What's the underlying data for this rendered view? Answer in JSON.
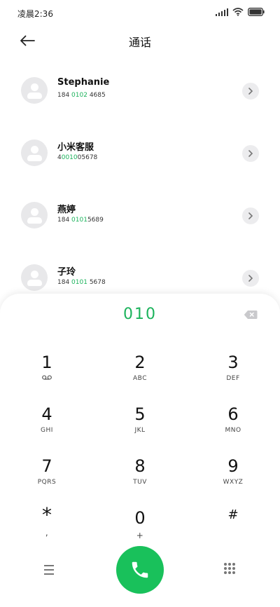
{
  "status": {
    "time": "凌晨2:36"
  },
  "header": {
    "title": "通话"
  },
  "contacts": [
    {
      "name": "Stephanie",
      "number_pre": "184 ",
      "number_hl": "0102",
      "number_post": " 4685"
    },
    {
      "name": "小米客服",
      "number_pre": "4",
      "number_hl": "0010",
      "number_post": "05678"
    },
    {
      "name": "燕婷",
      "number_pre": "184 ",
      "number_hl": "0101",
      "number_post": "5689"
    },
    {
      "name": "子玲",
      "number_pre": "184 ",
      "number_hl": "0101",
      "number_post": " 5678"
    }
  ],
  "dial": {
    "entered": "010"
  },
  "keypad": [
    {
      "digit": "1",
      "letters": ""
    },
    {
      "digit": "2",
      "letters": "ABC"
    },
    {
      "digit": "3",
      "letters": "DEF"
    },
    {
      "digit": "4",
      "letters": "GHI"
    },
    {
      "digit": "5",
      "letters": "JKL"
    },
    {
      "digit": "6",
      "letters": "MNO"
    },
    {
      "digit": "7",
      "letters": "PQRS"
    },
    {
      "digit": "8",
      "letters": "TUV"
    },
    {
      "digit": "9",
      "letters": "WXYZ"
    },
    {
      "digit": "*",
      "letters": ","
    },
    {
      "digit": "0",
      "letters": "+"
    },
    {
      "digit": "#",
      "letters": ""
    }
  ],
  "colors": {
    "accent": "#1cb35c",
    "call": "#19c15b"
  },
  "icons": {
    "back": "arrow-left-icon",
    "chevron": "chevron-right-icon",
    "backspace": "backspace-icon",
    "voicemail": "voicemail-icon",
    "menu": "menu-icon",
    "call": "phone-icon",
    "keypad": "keypad-grid-icon"
  }
}
